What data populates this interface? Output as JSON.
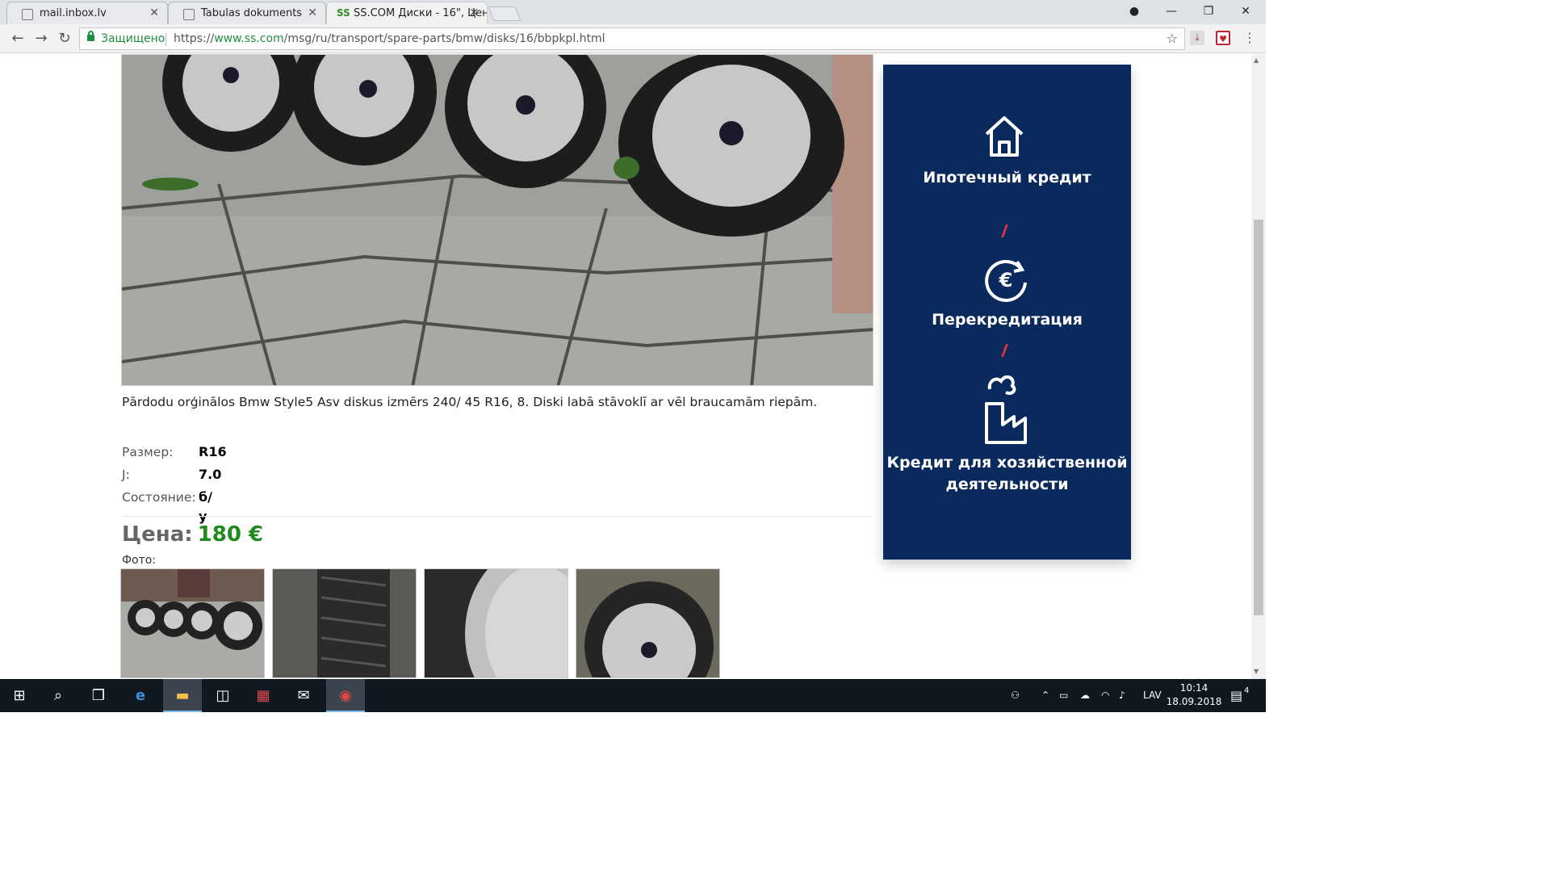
{
  "browser": {
    "tabs": [
      {
        "title": "mail.inbox.lv",
        "active": false
      },
      {
        "title": "Tabulas dokuments",
        "active": false
      },
      {
        "title": "SS.COM Диски - 16\", Цен",
        "favicon_text": "SS",
        "active": true
      }
    ],
    "secure_label": "Защищено",
    "url_prefix": "https://",
    "url_host": "www.ss.com",
    "url_path": "/msg/ru/transport/spare-parts/bmw/disks/16/bbpkpl.html"
  },
  "listing": {
    "description": "Pārdodu orģinālos Bmw Style5 Asv diskus izmērs 240/ 45 R16, 8. Diski labā stāvoklī ar vēl braucamām riepām.",
    "attributes": [
      {
        "label": "Размер:",
        "value": "R16"
      },
      {
        "label": "J:",
        "value": "7.0"
      },
      {
        "label": "Состояние:",
        "value": "б/у"
      }
    ],
    "price_label": "Цена:",
    "price_value": "180 €",
    "photos_label": "Фото:",
    "photo_count": 4
  },
  "ad": {
    "item1": "Ипотечный кредит",
    "item2": "Перекредитация",
    "item3": "Кредит для хозяйственной деятельности",
    "accent_color": "#d9363e",
    "bg_color": "#0a2a5e"
  },
  "taskbar": {
    "language": "LAV",
    "time": "10:14",
    "date": "18.09.2018",
    "notification_count": "4"
  }
}
